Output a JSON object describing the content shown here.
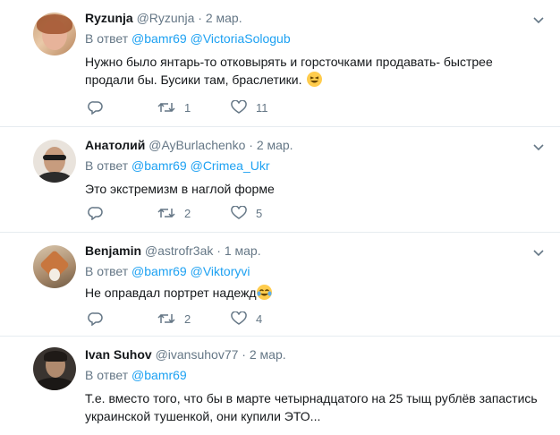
{
  "reply_prefix": "В ответ",
  "tweets": [
    {
      "name": "Ryzunja",
      "handle": "@Ryzunja",
      "time": "2 мар.",
      "reply_to": [
        "@bamr69",
        "@VictoriaSologub"
      ],
      "text": "Нужно было янтарь-то отковырять и горсточками продавать- быстрее продали бы. Бусики там, браслетики.",
      "emoji": "laughing-emoji",
      "retweets": "1",
      "likes": "11"
    },
    {
      "name": "Анатолий",
      "handle": "@AyBurlachenko",
      "time": "2 мар.",
      "reply_to": [
        "@bamr69",
        "@Crimea_Ukr"
      ],
      "text": "Это экстремизм в наглой форме",
      "retweets": "2",
      "likes": "5"
    },
    {
      "name": "Benjamin",
      "handle": "@astrofr3ak",
      "time": "1 мар.",
      "reply_to": [
        "@bamr69",
        "@Viktoryvi"
      ],
      "text": "Не оправдал портрет надежд",
      "emoji": "tears-of-joy-emoji",
      "retweets": "2",
      "likes": "4"
    },
    {
      "name": "Ivan Suhov",
      "handle": "@ivansuhov77",
      "time": "2 мар.",
      "reply_to": [
        "@bamr69"
      ],
      "text": "Т.е. вместо того, что бы в марте четырнадцатого на 25 тыщ рублёв запастись украинской тушенкой, они купили ЭТО...",
      "retweets": "",
      "likes": ""
    }
  ]
}
